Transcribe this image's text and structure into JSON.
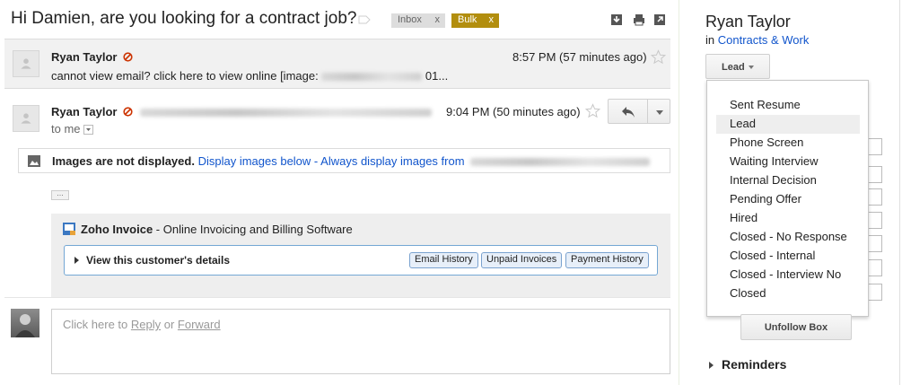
{
  "header": {
    "subject": "Hi Damien, are you looking for a contract job?",
    "labels": [
      {
        "name": "Inbox",
        "remove": "x",
        "color": "#dddddd"
      },
      {
        "name": "Bulk",
        "remove": "x",
        "color": "#b28e0e"
      }
    ],
    "icons": [
      "download-icon",
      "print-icon",
      "new-window-icon"
    ]
  },
  "messages": [
    {
      "sender": "Ryan Taylor",
      "time": "8:57 PM (57 minutes ago)",
      "snippet_start": "cannot view email? click here to view online [image: ",
      "snippet_end": " 01..."
    },
    {
      "sender": "Ryan Taylor",
      "time": "9:04 PM (50 minutes ago)",
      "to_label": "to me"
    }
  ],
  "images_bar": {
    "warning": "Images are not displayed.",
    "display_below": "Display images below",
    "separator": " - ",
    "always_display": "Always display images from"
  },
  "ellipsis": "...",
  "zoho": {
    "brand": "Zoho Invoice",
    "tagline": " - Online Invoicing and Billing Software",
    "view_details": "View this customer's details",
    "buttons": [
      "Email History",
      "Unpaid Invoices",
      "Payment History"
    ]
  },
  "reply_box": {
    "prefix": "Click here to ",
    "reply": "Reply",
    "middle": " or ",
    "forward": "Forward"
  },
  "contact": {
    "name": "Ryan Taylor",
    "in_label": "in ",
    "pipeline": "Contracts & Work",
    "stage": "Lead"
  },
  "stage_menu": {
    "items": [
      "Sent Resume",
      "Lead",
      "Phone Screen",
      "Waiting Interview",
      "Internal Decision",
      "Pending Offer",
      "Hired",
      "Closed - No Response",
      "Closed - Internal",
      "Closed - Interview No",
      "Closed"
    ],
    "selected": "Lead"
  },
  "unfollow_label": "Unfollow Box",
  "reminders_label": "Reminders",
  "colors": {
    "link": "#1155cc",
    "bulk_label": "#b28e0e",
    "star_outline": "#c8c8c8",
    "spam_icon": "#cc3300"
  }
}
